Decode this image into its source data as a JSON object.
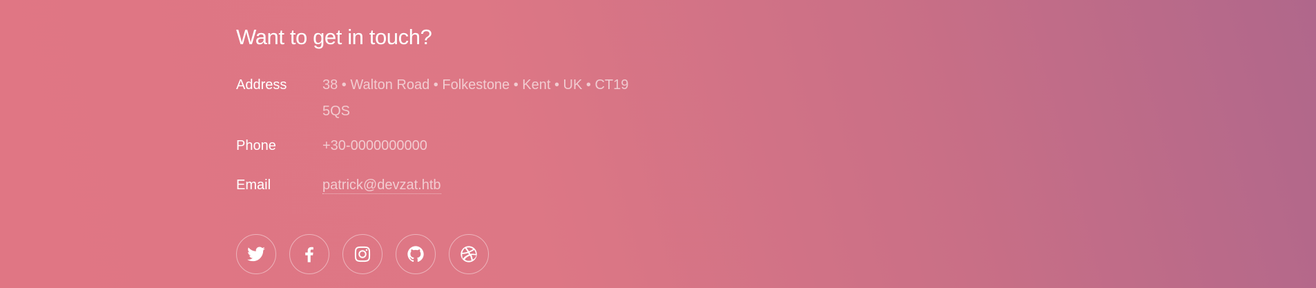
{
  "contact": {
    "heading": "Want to get in touch?",
    "address_label": "Address",
    "address_value": "38 • Walton Road • Folkestone • Kent • UK • CT19 5QS",
    "phone_label": "Phone",
    "phone_value": "+30-0000000000",
    "email_label": "Email",
    "email_value": "patrick@devzat.htb"
  },
  "social": {
    "icons": [
      "twitter-icon",
      "facebook-icon",
      "instagram-icon",
      "github-icon",
      "dribbble-icon"
    ]
  },
  "colors": {
    "gradient_start": "#e07684",
    "gradient_end": "#b0678b",
    "text": "#ffffff"
  }
}
